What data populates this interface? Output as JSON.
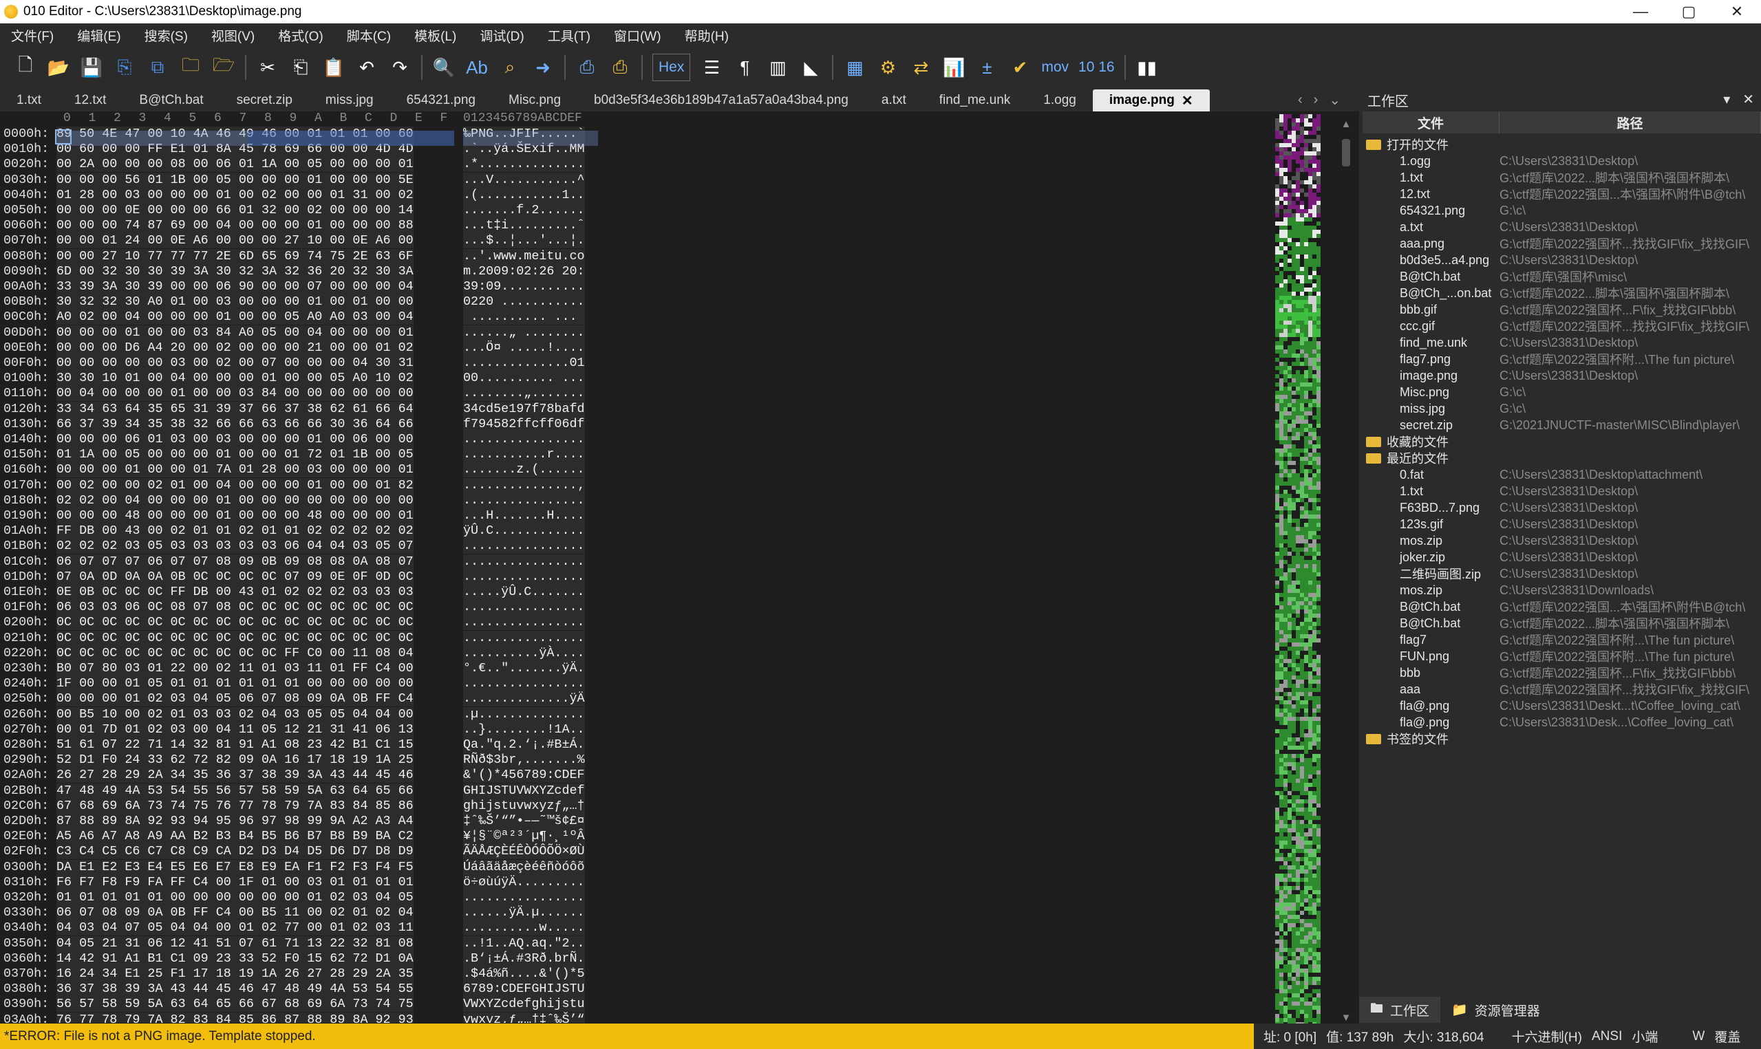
{
  "window": {
    "title": "010 Editor - C:\\Users\\23831\\Desktop\\image.png",
    "controls": {
      "minimize": "—",
      "maximize": "▢",
      "close": "✕"
    }
  },
  "menu": [
    "文件(F)",
    "编辑(E)",
    "搜索(S)",
    "视图(V)",
    "格式(O)",
    "脚本(C)",
    "模板(L)",
    "调试(D)",
    "工具(T)",
    "窗口(W)",
    "帮助(H)"
  ],
  "toolbar": {
    "hex_label": "Hex",
    "mov_label": "mov",
    "hex_num_label": "10 16"
  },
  "tabs": [
    {
      "label": "1.txt",
      "active": false
    },
    {
      "label": "12.txt",
      "active": false
    },
    {
      "label": "B@tCh.bat",
      "active": false
    },
    {
      "label": "secret.zip",
      "active": false
    },
    {
      "label": "miss.jpg",
      "active": false
    },
    {
      "label": "654321.png",
      "active": false
    },
    {
      "label": "Misc.png",
      "active": false
    },
    {
      "label": "b0d3e5f34e36b189b47a1a57a0a43ba4.png",
      "active": false
    },
    {
      "label": "a.txt",
      "active": false
    },
    {
      "label": "find_me.unk",
      "active": false
    },
    {
      "label": "1.ogg",
      "active": false
    },
    {
      "label": "image.png",
      "active": true
    }
  ],
  "hex_header": {
    "columns": [
      "0",
      "1",
      "2",
      "3",
      "4",
      "5",
      "6",
      "7",
      "8",
      "9",
      "A",
      "B",
      "C",
      "D",
      "E",
      "F"
    ],
    "char_header": "0123456789ABCDEF"
  },
  "hex_rows": [
    {
      "addr": "0000h:",
      "bytes": "89 50 4E 47 00 10 4A 46 49 46 00 01 01 01 00 60",
      "chars": "‰PNG..JFIF.....`"
    },
    {
      "addr": "0010h:",
      "bytes": "00 60 00 00 FF E1 01 8A 45 78 69 66 00 00 4D 4D",
      "chars": ".`..ÿá.ŠExif..MM"
    },
    {
      "addr": "0020h:",
      "bytes": "00 2A 00 00 00 08 00 06 01 1A 00 05 00 00 00 01",
      "chars": ".*.............."
    },
    {
      "addr": "0030h:",
      "bytes": "00 00 00 56 01 1B 00 05 00 00 00 01 00 00 00 5E",
      "chars": "...V...........^"
    },
    {
      "addr": "0040h:",
      "bytes": "01 28 00 03 00 00 00 01 00 02 00 00 01 31 00 02",
      "chars": ".(...........1.."
    },
    {
      "addr": "0050h:",
      "bytes": "00 00 00 0E 00 00 00 66 01 32 00 02 00 00 00 14",
      "chars": ".......f.2......"
    },
    {
      "addr": "0060h:",
      "bytes": "00 00 00 74 87 69 00 04 00 00 00 01 00 00 00 88",
      "chars": "...t‡i.........ˆ"
    },
    {
      "addr": "0070h:",
      "bytes": "00 00 01 24 00 0E A6 00 00 00 27 10 00 0E A6 00",
      "chars": "...$..¦...'...¦."
    },
    {
      "addr": "0080h:",
      "bytes": "00 00 27 10 77 77 77 2E 6D 65 69 74 75 2E 63 6F",
      "chars": "..'.www.meitu.co"
    },
    {
      "addr": "0090h:",
      "bytes": "6D 00 32 30 30 39 3A 30 32 3A 32 36 20 32 30 3A",
      "chars": "m.2009:02:26 20:"
    },
    {
      "addr": "00A0h:",
      "bytes": "33 39 3A 30 39 00 00 06 90 00 00 07 00 00 00 04",
      "chars": "39:09..........."
    },
    {
      "addr": "00B0h:",
      "bytes": "30 32 32 30 A0 01 00 03 00 00 00 01 00 01 00 00",
      "chars": "0220 ..........."
    },
    {
      "addr": "00C0h:",
      "bytes": "A0 02 00 04 00 00 00 01 00 00 05 A0 A0 03 00 04",
      "chars": " .......... ... "
    },
    {
      "addr": "00D0h:",
      "bytes": "00 00 00 01 00 00 03 84 A0 05 00 04 00 00 00 01",
      "chars": "......„ ........"
    },
    {
      "addr": "00E0h:",
      "bytes": "00 00 00 D6 A4 20 00 02 00 00 00 21 00 00 01 02",
      "chars": "...Ö¤ .....!...."
    },
    {
      "addr": "00F0h:",
      "bytes": "00 00 00 00 00 03 00 02 00 07 00 00 00 04 30 31",
      "chars": "..............01"
    },
    {
      "addr": "0100h:",
      "bytes": "30 30 10 01 00 04 00 00 00 01 00 00 05 A0 10 02",
      "chars": "00.......... ..."
    },
    {
      "addr": "0110h:",
      "bytes": "00 04 00 00 00 01 00 00 03 84 00 00 00 00 00 00",
      "chars": "........„......."
    },
    {
      "addr": "0120h:",
      "bytes": "33 34 63 64 35 65 31 39 37 66 37 38 62 61 66 64",
      "chars": "34cd5e197f78bafd"
    },
    {
      "addr": "0130h:",
      "bytes": "66 37 39 34 35 38 32 66 66 63 66 66 30 36 64 66",
      "chars": "f794582ffcff06df"
    },
    {
      "addr": "0140h:",
      "bytes": "00 00 00 06 01 03 00 03 00 00 00 01 00 06 00 00",
      "chars": "................"
    },
    {
      "addr": "0150h:",
      "bytes": "01 1A 00 05 00 00 00 01 00 00 01 72 01 1B 00 05",
      "chars": "...........r...."
    },
    {
      "addr": "0160h:",
      "bytes": "00 00 00 01 00 00 01 7A 01 28 00 03 00 00 00 01",
      "chars": ".......z.(......"
    },
    {
      "addr": "0170h:",
      "bytes": "00 02 00 00 02 01 00 04 00 00 00 01 00 00 01 82",
      "chars": "...............‚"
    },
    {
      "addr": "0180h:",
      "bytes": "02 02 00 04 00 00 00 01 00 00 00 00 00 00 00 00",
      "chars": "................"
    },
    {
      "addr": "0190h:",
      "bytes": "00 00 00 48 00 00 00 01 00 00 00 48 00 00 00 01",
      "chars": "...H.......H...."
    },
    {
      "addr": "01A0h:",
      "bytes": "FF DB 00 43 00 02 01 01 02 01 01 02 02 02 02 02",
      "chars": "ÿÛ.C............"
    },
    {
      "addr": "01B0h:",
      "bytes": "02 02 02 03 05 03 03 03 03 03 06 04 04 03 05 07",
      "chars": "................"
    },
    {
      "addr": "01C0h:",
      "bytes": "06 07 07 07 06 07 07 08 09 0B 09 08 08 0A 08 07",
      "chars": "................"
    },
    {
      "addr": "01D0h:",
      "bytes": "07 0A 0D 0A 0A 0B 0C 0C 0C 0C 07 09 0E 0F 0D 0C",
      "chars": "................"
    },
    {
      "addr": "01E0h:",
      "bytes": "0E 0B 0C 0C 0C FF DB 00 43 01 02 02 02 03 03 03",
      "chars": ".....ÿÛ.C......."
    },
    {
      "addr": "01F0h:",
      "bytes": "06 03 03 06 0C 08 07 08 0C 0C 0C 0C 0C 0C 0C 0C",
      "chars": "................"
    },
    {
      "addr": "0200h:",
      "bytes": "0C 0C 0C 0C 0C 0C 0C 0C 0C 0C 0C 0C 0C 0C 0C 0C",
      "chars": "................"
    },
    {
      "addr": "0210h:",
      "bytes": "0C 0C 0C 0C 0C 0C 0C 0C 0C 0C 0C 0C 0C 0C 0C 0C",
      "chars": "................"
    },
    {
      "addr": "0220h:",
      "bytes": "0C 0C 0C 0C 0C 0C 0C 0C 0C 0C FF C0 00 11 08 04",
      "chars": "..........ÿÀ...."
    },
    {
      "addr": "0230h:",
      "bytes": "B0 07 80 03 01 22 00 02 11 01 03 11 01 FF C4 00",
      "chars": "°.€..\".......ÿÄ."
    },
    {
      "addr": "0240h:",
      "bytes": "1F 00 00 01 05 01 01 01 01 01 01 00 00 00 00 00",
      "chars": "................"
    },
    {
      "addr": "0250h:",
      "bytes": "00 00 00 01 02 03 04 05 06 07 08 09 0A 0B FF C4",
      "chars": "..............ÿÄ"
    },
    {
      "addr": "0260h:",
      "bytes": "00 B5 10 00 02 01 03 03 02 04 03 05 05 04 04 00",
      "chars": ".µ.............."
    },
    {
      "addr": "0270h:",
      "bytes": "00 01 7D 01 02 03 00 04 11 05 12 21 31 41 06 13",
      "chars": "..}........!1A.."
    },
    {
      "addr": "0280h:",
      "bytes": "51 61 07 22 71 14 32 81 91 A1 08 23 42 B1 C1 15",
      "chars": "Qa.\"q.2.‘¡.#B±Á."
    },
    {
      "addr": "0290h:",
      "bytes": "52 D1 F0 24 33 62 72 82 09 0A 16 17 18 19 1A 25",
      "chars": "RÑð$3br‚.......%"
    },
    {
      "addr": "02A0h:",
      "bytes": "26 27 28 29 2A 34 35 36 37 38 39 3A 43 44 45 46",
      "chars": "&'()*456789:CDEF"
    },
    {
      "addr": "02B0h:",
      "bytes": "47 48 49 4A 53 54 55 56 57 58 59 5A 63 64 65 66",
      "chars": "GHIJSTUVWXYZcdef"
    },
    {
      "addr": "02C0h:",
      "bytes": "67 68 69 6A 73 74 75 76 77 78 79 7A 83 84 85 86",
      "chars": "ghijstuvwxyzƒ„…†"
    },
    {
      "addr": "02D0h:",
      "bytes": "87 88 89 8A 92 93 94 95 96 97 98 99 9A A2 A3 A4",
      "chars": "‡ˆ‰Š’“”•–—˜™š¢£¤"
    },
    {
      "addr": "02E0h:",
      "bytes": "A5 A6 A7 A8 A9 AA B2 B3 B4 B5 B6 B7 B8 B9 BA C2",
      "chars": "¥¦§¨©ª²³´µ¶·¸¹ºÂ"
    },
    {
      "addr": "02F0h:",
      "bytes": "C3 C4 C5 C6 C7 C8 C9 CA D2 D3 D4 D5 D6 D7 D8 D9",
      "chars": "ÃÄÅÆÇÈÉÊÒÓÔÕÖ×ØÙ"
    },
    {
      "addr": "0300h:",
      "bytes": "DA E1 E2 E3 E4 E5 E6 E7 E8 E9 EA F1 F2 F3 F4 F5",
      "chars": "Úáâãäåæçèéêñòóôõ"
    },
    {
      "addr": "0310h:",
      "bytes": "F6 F7 F8 F9 FA FF C4 00 1F 01 00 03 01 01 01 01",
      "chars": "ö÷øùúÿÄ........."
    },
    {
      "addr": "0320h:",
      "bytes": "01 01 01 01 01 00 00 00 00 00 00 01 02 03 04 05",
      "chars": "................"
    },
    {
      "addr": "0330h:",
      "bytes": "06 07 08 09 0A 0B FF C4 00 B5 11 00 02 01 02 04",
      "chars": "......ÿÄ.µ......"
    },
    {
      "addr": "0340h:",
      "bytes": "04 03 04 07 05 04 04 00 01 02 77 00 01 02 03 11",
      "chars": "..........w....."
    },
    {
      "addr": "0350h:",
      "bytes": "04 05 21 31 06 12 41 51 07 61 71 13 22 32 81 08",
      "chars": "..!1..AQ.aq.\"2.."
    },
    {
      "addr": "0360h:",
      "bytes": "14 42 91 A1 B1 C1 09 23 33 52 F0 15 62 72 D1 0A",
      "chars": ".B‘¡±Á.#3Rð.brÑ."
    },
    {
      "addr": "0370h:",
      "bytes": "16 24 34 E1 25 F1 17 18 19 1A 26 27 28 29 2A 35",
      "chars": ".$4á%ñ....&'()*5"
    },
    {
      "addr": "0380h:",
      "bytes": "36 37 38 39 3A 43 44 45 46 47 48 49 4A 53 54 55",
      "chars": "6789:CDEFGHIJSTU"
    },
    {
      "addr": "0390h:",
      "bytes": "56 57 58 59 5A 63 64 65 66 67 68 69 6A 73 74 75",
      "chars": "VWXYZcdefghijstu"
    },
    {
      "addr": "03A0h:",
      "bytes": "76 77 78 79 7A 82 83 84 85 86 87 88 89 8A 92 93",
      "chars": "vwxyz‚ƒ„…†‡ˆ‰Š’“"
    }
  ],
  "workspace": {
    "title": "工作区",
    "col_file": "文件",
    "col_path": "路径",
    "groups": [
      {
        "label": "打开的文件",
        "items": [
          {
            "name": "1.ogg",
            "path": "C:\\Users\\23831\\Desktop\\"
          },
          {
            "name": "1.txt",
            "path": "G:\\ctf题库\\2022...脚本\\强国杯\\强国杯脚本\\"
          },
          {
            "name": "12.txt",
            "path": "G:\\ctf题库\\2022强国...本\\强国杯\\附件\\B@tch\\"
          },
          {
            "name": "654321.png",
            "path": "G:\\c\\"
          },
          {
            "name": "a.txt",
            "path": "C:\\Users\\23831\\Desktop\\"
          },
          {
            "name": "aaa.png",
            "path": "G:\\ctf题库\\2022强国杯...找找GIF\\fix_找找GIF\\"
          },
          {
            "name": "b0d3e5...a4.png",
            "path": "C:\\Users\\23831\\Desktop\\"
          },
          {
            "name": "B@tCh.bat",
            "path": "G:\\ctf题库\\强国杯\\misc\\"
          },
          {
            "name": "B@tCh_...on.bat",
            "path": "G:\\ctf题库\\2022...脚本\\强国杯\\强国杯脚本\\"
          },
          {
            "name": "bbb.gif",
            "path": "G:\\ctf题库\\2022强国杯...F\\fix_找找GIF\\bbb\\"
          },
          {
            "name": "ccc.gif",
            "path": "G:\\ctf题库\\2022强国杯...找找GIF\\fix_找找GIF\\"
          },
          {
            "name": "find_me.unk",
            "path": "C:\\Users\\23831\\Desktop\\"
          },
          {
            "name": "flag7.png",
            "path": "G:\\ctf题库\\2022强国杯附...\\The fun picture\\"
          },
          {
            "name": "image.png",
            "path": "C:\\Users\\23831\\Desktop\\"
          },
          {
            "name": "Misc.png",
            "path": "G:\\c\\"
          },
          {
            "name": "miss.jpg",
            "path": "G:\\c\\"
          },
          {
            "name": "secret.zip",
            "path": "G:\\2021JNUCTF-master\\MISC\\Blind\\player\\"
          }
        ]
      },
      {
        "label": "收藏的文件",
        "items": []
      },
      {
        "label": "最近的文件",
        "items": [
          {
            "name": "0.fat",
            "path": "C:\\Users\\23831\\Desktop\\attachment\\"
          },
          {
            "name": "1.txt",
            "path": "C:\\Users\\23831\\Desktop\\"
          },
          {
            "name": "F63BD...7.png",
            "path": "C:\\Users\\23831\\Desktop\\"
          },
          {
            "name": "123s.gif",
            "path": "C:\\Users\\23831\\Desktop\\"
          },
          {
            "name": "mos.zip",
            "path": "C:\\Users\\23831\\Desktop\\"
          },
          {
            "name": "joker.zip",
            "path": "C:\\Users\\23831\\Desktop\\"
          },
          {
            "name": "二维码画图.zip",
            "path": "C:\\Users\\23831\\Desktop\\"
          },
          {
            "name": "mos.zip",
            "path": "C:\\Users\\23831\\Downloads\\"
          },
          {
            "name": "B@tCh.bat",
            "path": "G:\\ctf题库\\2022强国...本\\强国杯\\附件\\B@tch\\"
          },
          {
            "name": "B@tCh.bat",
            "path": "G:\\ctf题库\\2022...脚本\\强国杯\\强国杯脚本\\"
          },
          {
            "name": "flag7",
            "path": "G:\\ctf题库\\2022强国杯附...\\The fun picture\\"
          },
          {
            "name": "FUN.png",
            "path": "G:\\ctf题库\\2022强国杯附...\\The fun picture\\"
          },
          {
            "name": "bbb",
            "path": "G:\\ctf题库\\2022强国杯...F\\fix_找找GIF\\bbb\\"
          },
          {
            "name": "aaa",
            "path": "G:\\ctf题库\\2022强国杯...找找GIF\\fix_找找GIF\\"
          },
          {
            "name": "fla@.png",
            "path": "C:\\Users\\23831\\Deskt...t\\Coffee_loving_cat\\"
          },
          {
            "name": "fla@.png",
            "path": "C:\\Users\\23831\\Desk...\\Coffee_loving_cat\\"
          }
        ]
      },
      {
        "label": "书签的文件",
        "items": []
      }
    ],
    "bottom_tabs": [
      "工作区",
      "资源管理器"
    ]
  },
  "status": {
    "error": "*ERROR: File is not a PNG image. Template stopped.",
    "address": "址: 0 [0h]",
    "value": "值: 137 89h",
    "size": "大小: 318,604",
    "mode": "十六进制(H)",
    "encoding": "ANSI",
    "endian": "小端",
    "insert": "W",
    "overwrite": "覆盖"
  },
  "colors": {
    "error_bg": "#f3bd0e",
    "selection": "#4a6eb8",
    "minimap_purple": "#7a1a7a",
    "minimap_green": "#2d8a2d"
  }
}
